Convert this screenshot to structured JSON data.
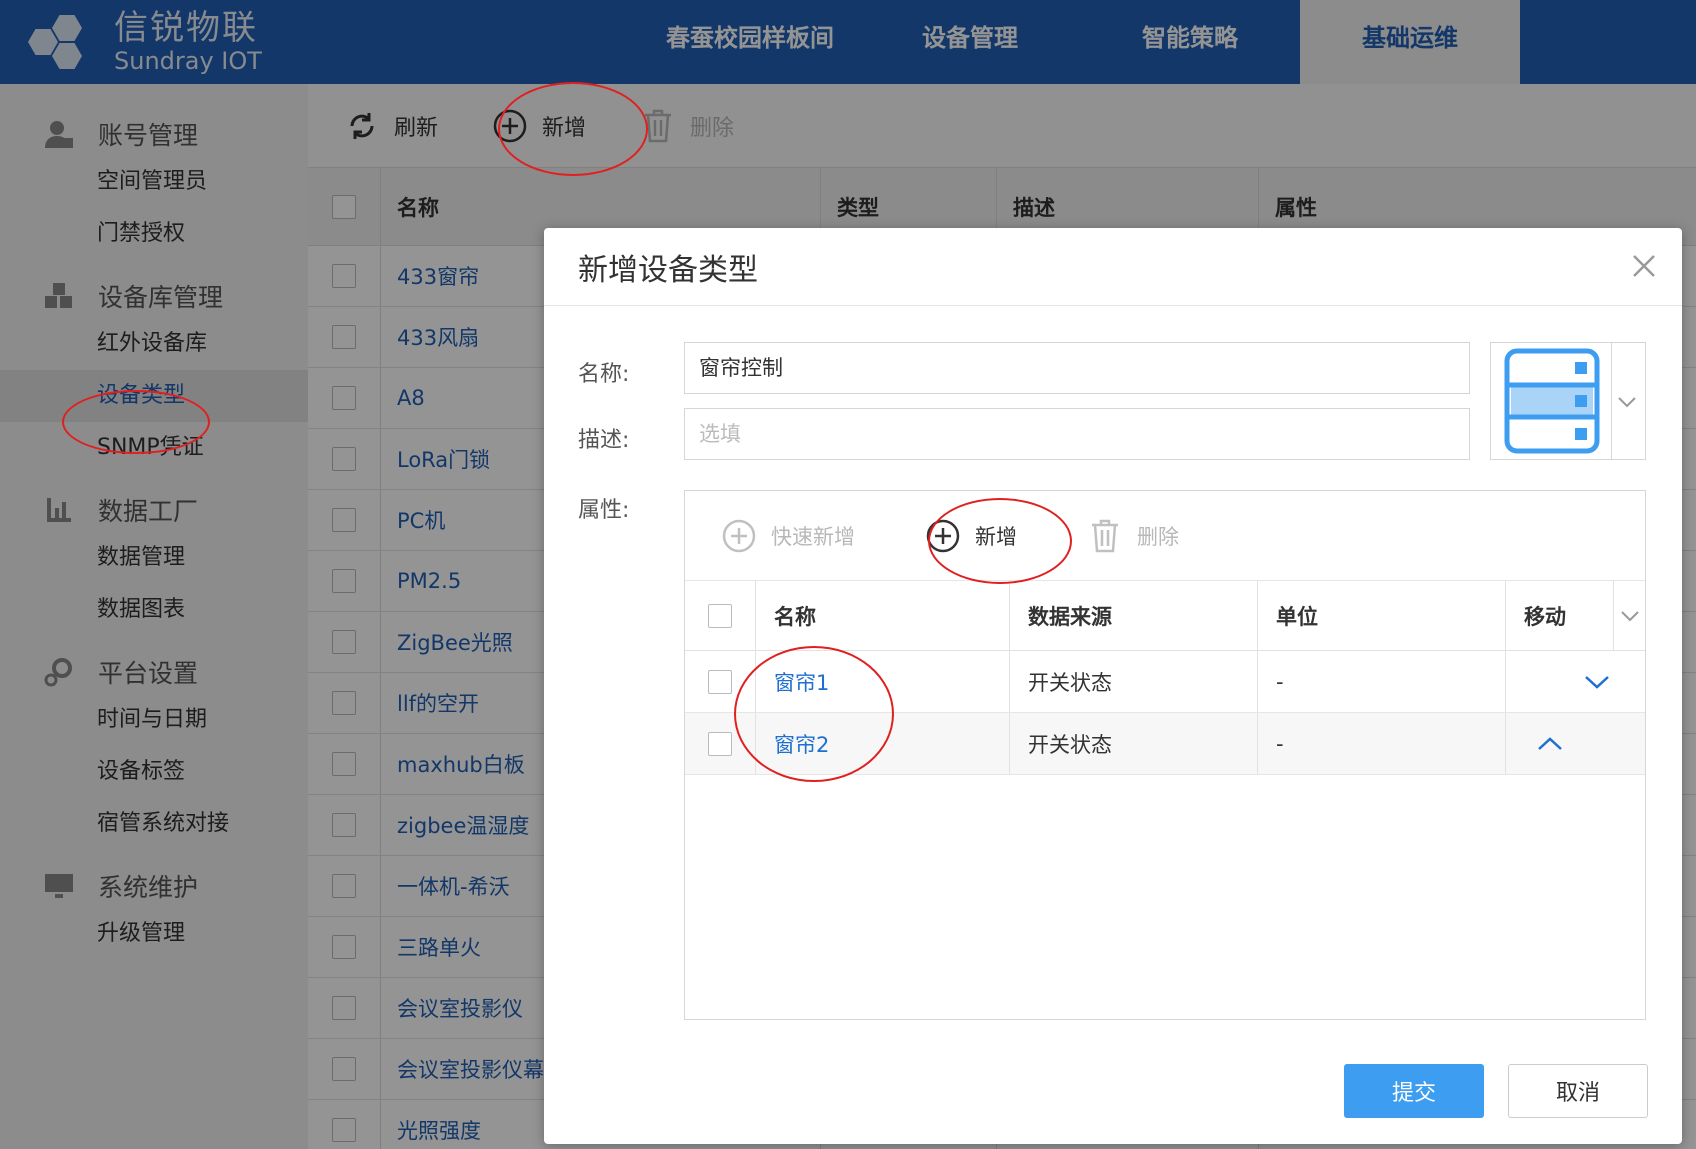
{
  "app": {
    "brand_cn": "信锐物联",
    "brand_en": "Sundray IOT"
  },
  "nav": [
    {
      "label": "春蚕校园样板间"
    },
    {
      "label": "设备管理"
    },
    {
      "label": "智能策略"
    },
    {
      "label": "基础运维",
      "active": true
    }
  ],
  "sidebar": {
    "groups": [
      {
        "label": "账号管理",
        "icon": "user-icon",
        "items": [
          "空间管理员",
          "门禁授权"
        ]
      },
      {
        "label": "设备库管理",
        "icon": "cubes-icon",
        "items": [
          "红外设备库",
          "设备类型",
          "SNMP凭证"
        ]
      },
      {
        "label": "数据工厂",
        "icon": "chart-icon",
        "items": [
          "数据管理",
          "数据图表"
        ]
      },
      {
        "label": "平台设置",
        "icon": "gear-icon",
        "items": [
          "时间与日期",
          "设备标签",
          "宿管系统对接"
        ]
      },
      {
        "label": "系统维护",
        "icon": "monitor-icon",
        "items": [
          "升级管理"
        ]
      }
    ],
    "active_item": "设备类型"
  },
  "toolbar": {
    "refresh": "刷新",
    "add": "新增",
    "delete": "删除"
  },
  "list": {
    "columns": [
      "名称",
      "类型",
      "描述",
      "属性"
    ],
    "rows": [
      "433窗帘",
      "433风扇",
      "A8",
      "LoRa门锁",
      "PC机",
      "PM2.5",
      "ZigBee光照",
      "llf的空开",
      "maxhub白板",
      "zigbee温湿度",
      "一体机-希沃",
      "三路单火",
      "会议室投影仪",
      "会议室投影仪幕",
      "光照强度"
    ]
  },
  "modal": {
    "title": "新增设备类型",
    "name_label": "名称:",
    "name_value": "窗帘控制",
    "desc_label": "描述:",
    "desc_placeholder": "选填",
    "attr_label": "属性:",
    "attr_toolbar": {
      "quick_add": "快速新增",
      "add": "新增",
      "delete": "删除"
    },
    "attr_columns": [
      "名称",
      "数据来源",
      "单位",
      "移动"
    ],
    "attr_rows": [
      {
        "name": "窗帘1",
        "source": "开关状态",
        "unit": "-",
        "move": "down"
      },
      {
        "name": "窗帘2",
        "source": "开关状态",
        "unit": "-",
        "move": "up"
      }
    ],
    "submit": "提交",
    "cancel": "取消"
  },
  "colors": {
    "brand": "#1f5fb4",
    "accent": "#3d9df0",
    "annotation": "#e02020"
  }
}
